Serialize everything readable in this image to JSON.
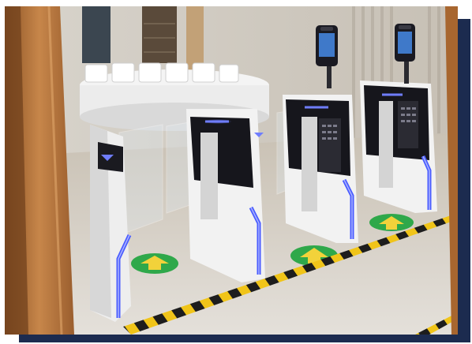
{
  "image": {
    "subject": "turnstile-gates",
    "colors": {
      "navy_frame": "#1c2b4f",
      "led_blue": "#4a5cff",
      "floor_sign_green": "#2fa84a",
      "arrow_yellow": "#f2d23a",
      "hazard_yellow": "#f0c419",
      "panel_white": "#f2f2f2",
      "panel_black": "#16161c",
      "wood": "#b9773f"
    }
  }
}
